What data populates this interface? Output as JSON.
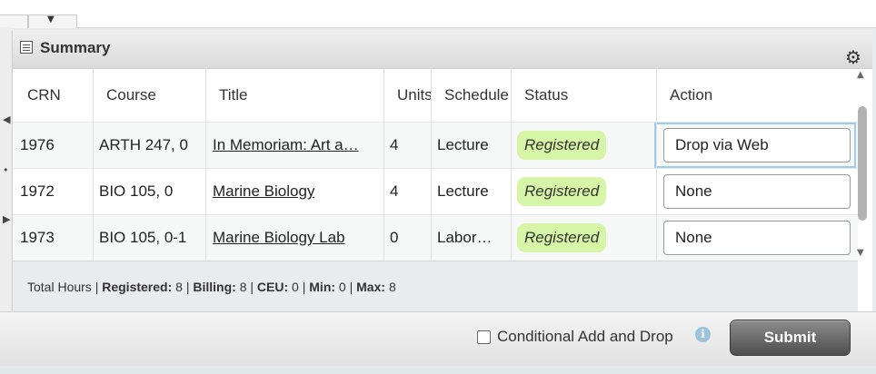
{
  "panel": {
    "title": "Summary",
    "title_icon": "table-icon"
  },
  "columns": [
    "CRN",
    "Course",
    "Title",
    "Units",
    "Schedule",
    "Status",
    "Action"
  ],
  "rows": [
    {
      "crn": "1976",
      "course": "ARTH 247, 0",
      "title": "In Memoriam: Art a…",
      "units": "4",
      "schedule": "Lecture",
      "status": "Registered",
      "action": "Drop via Web",
      "focused": true
    },
    {
      "crn": "1972",
      "course": "BIO 105, 0",
      "title": "Marine Biology",
      "units": "4",
      "schedule": "Lecture",
      "status": "Registered",
      "action": "None",
      "focused": false
    },
    {
      "crn": "1973",
      "course": "BIO 105, 0-1",
      "title": "Marine Biology Lab",
      "units": "0",
      "schedule": "Labor…",
      "status": "Registered",
      "action": "None",
      "focused": false
    }
  ],
  "totals": {
    "prefix": "Total Hours |",
    "registered_label": "Registered:",
    "registered_value": "8",
    "billing_label": "Billing:",
    "billing_value": "8",
    "ceu_label": "CEU:",
    "ceu_value": "0",
    "min_label": "Min:",
    "min_value": "0",
    "max_label": "Max:",
    "max_value": "8"
  },
  "footer": {
    "conditional_label": "Conditional Add and Drop",
    "conditional_checked": false,
    "submit_label": "Submit"
  },
  "colors": {
    "status_badge_bg": "#d6f5a6",
    "focus_ring": "#9ccdf0",
    "submit_bg": "#5e5e5e"
  }
}
